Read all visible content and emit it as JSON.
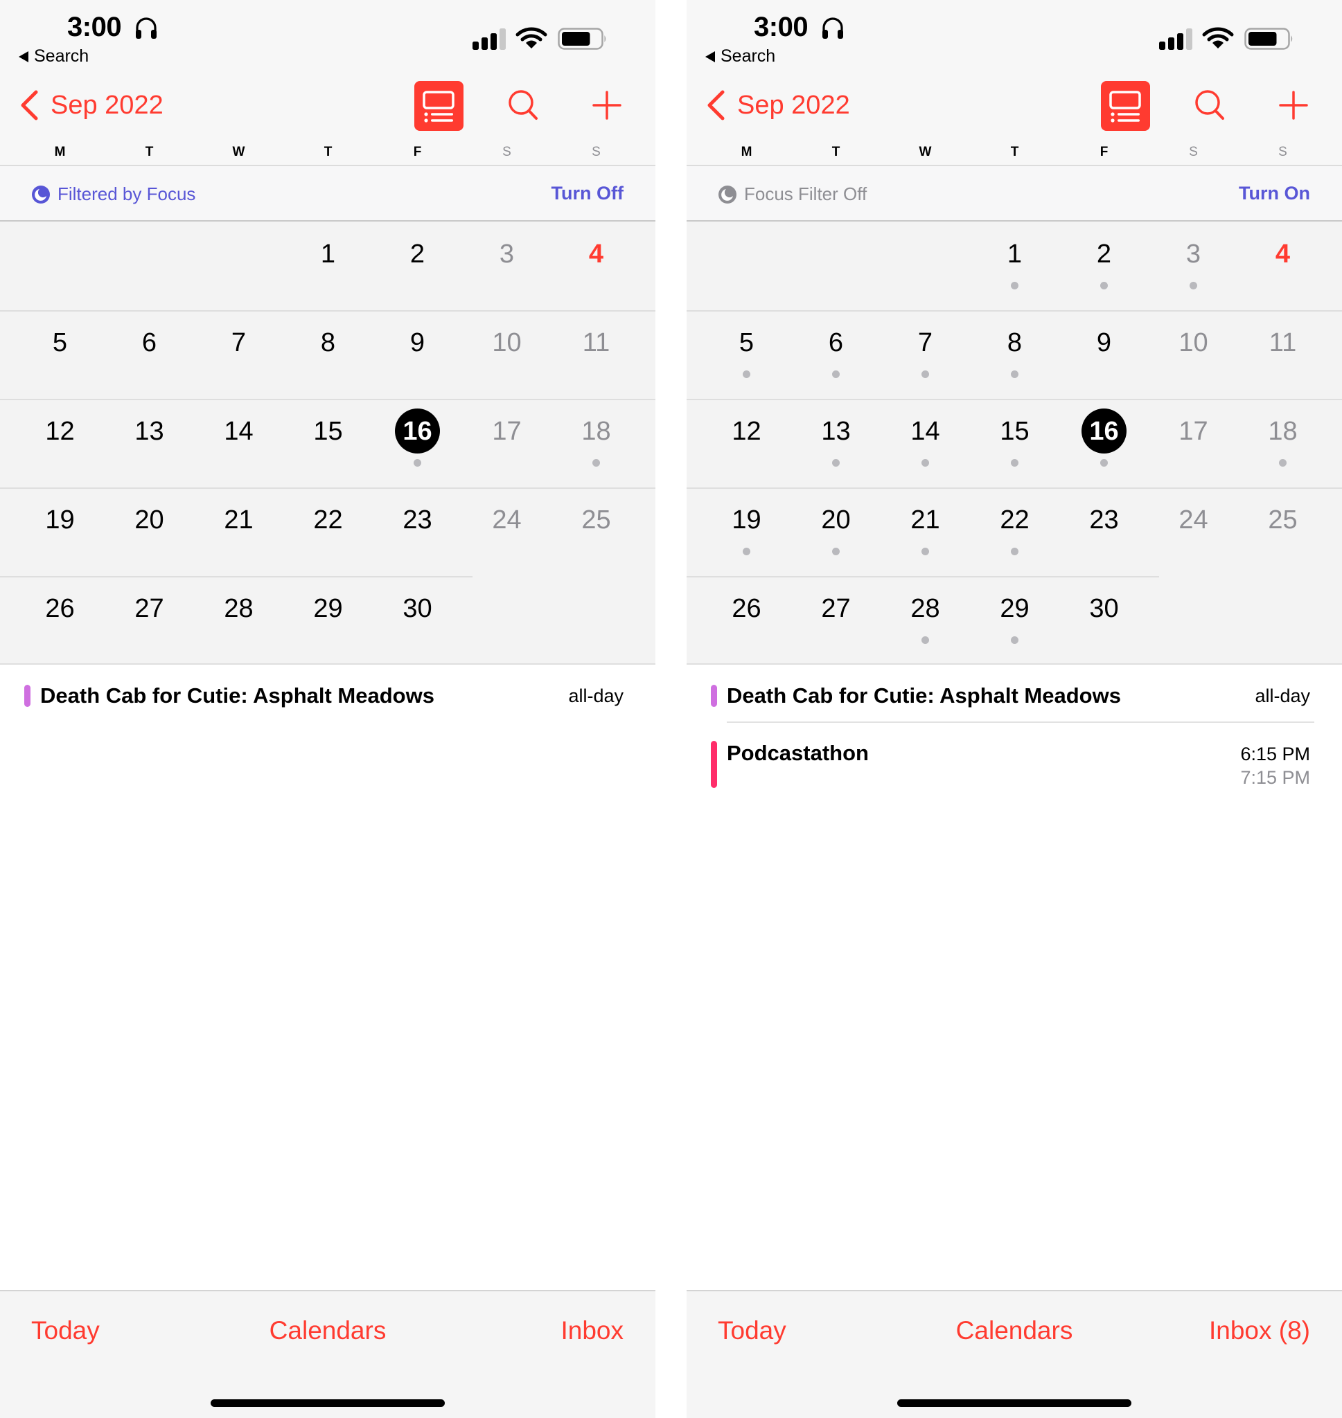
{
  "colors": {
    "accent": "#ff3b30",
    "focus_active": "#5856d6",
    "focus_inactive": "#8e8e93",
    "event_dot": "#b9b9bd"
  },
  "panels": [
    {
      "status": {
        "time": "3:00",
        "back_label": "Search",
        "battery_level": 0.75,
        "signal_bars": 3,
        "signal_bars_total": 4
      },
      "nav": {
        "back_icon": "chevron-left-icon",
        "month_title": "Sep 2022",
        "list_toggle_icon": "list-view-icon",
        "search_icon": "search-icon",
        "add_icon": "plus-icon"
      },
      "weekdays": [
        "M",
        "T",
        "W",
        "T",
        "F",
        "S",
        "S"
      ],
      "focus": {
        "icon": "moon-icon",
        "label": "Filtered by Focus",
        "action": "Turn Off",
        "active": true
      },
      "month": {
        "first_weekday_index": 3,
        "days_in_month": 30,
        "today": 16,
        "holiday": 4,
        "days_with_events": [
          16,
          18
        ]
      },
      "events": [
        {
          "title": "Death Cab for Cutie: Asphalt Meadows",
          "time": "all-day",
          "end_time": "",
          "color": "#cf6fe0"
        }
      ],
      "tabs": {
        "today": "Today",
        "calendars": "Calendars",
        "inbox": "Inbox"
      }
    },
    {
      "status": {
        "time": "3:00",
        "back_label": "Search",
        "battery_level": 0.75,
        "signal_bars": 3,
        "signal_bars_total": 4
      },
      "nav": {
        "back_icon": "chevron-left-icon",
        "month_title": "Sep 2022",
        "list_toggle_icon": "list-view-icon",
        "search_icon": "search-icon",
        "add_icon": "plus-icon"
      },
      "weekdays": [
        "M",
        "T",
        "W",
        "T",
        "F",
        "S",
        "S"
      ],
      "focus": {
        "icon": "moon-icon",
        "label": "Focus Filter Off",
        "action": "Turn On",
        "active": false
      },
      "month": {
        "first_weekday_index": 3,
        "days_in_month": 30,
        "today": 16,
        "holiday": 4,
        "days_with_events": [
          1,
          2,
          3,
          5,
          6,
          7,
          8,
          13,
          14,
          15,
          16,
          18,
          19,
          20,
          21,
          22,
          28,
          29
        ]
      },
      "events": [
        {
          "title": "Death Cab for Cutie: Asphalt Meadows",
          "time": "all-day",
          "end_time": "",
          "color": "#cf6fe0"
        },
        {
          "title": "Podcastathon",
          "time": "6:15 PM",
          "end_time": "7:15 PM",
          "color": "#ff2d6a"
        }
      ],
      "tabs": {
        "today": "Today",
        "calendars": "Calendars",
        "inbox": "Inbox (8)"
      }
    }
  ]
}
